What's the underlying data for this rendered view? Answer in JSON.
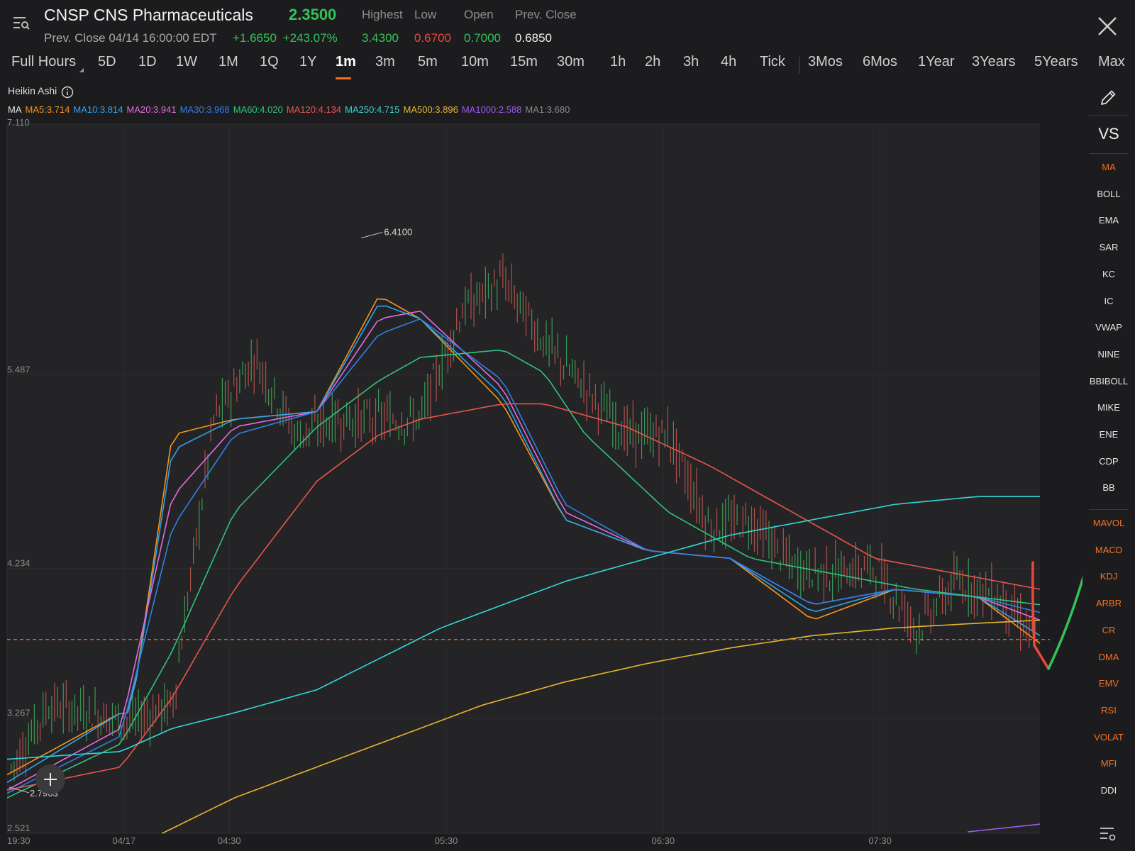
{
  "header": {
    "ticker_title": "CNSP CNS Pharmaceuticals",
    "price": "2.3500",
    "prev_close_line": "Prev. Close 04/14 16:00:00 EDT",
    "change_abs": "+1.6650",
    "change_pct": "+243.07%",
    "stats": [
      {
        "label": "Highest",
        "value": "3.4300",
        "color": "#33c25a"
      },
      {
        "label": "Low",
        "value": "0.6700",
        "color": "#f0453a"
      },
      {
        "label": "Open",
        "value": "0.7000",
        "color": "#33c25a"
      },
      {
        "label": "Prev. Close",
        "value": "0.6850",
        "color": "#f2f2f2"
      }
    ],
    "menu_icon": "list-search-icon",
    "close_icon": "close-icon"
  },
  "tabs": [
    "Full Hours",
    "5D",
    "1D",
    "1W",
    "1M",
    "1Q",
    "1Y",
    "1m",
    "3m",
    "5m",
    "10m",
    "15m",
    "30m",
    "1h",
    "2h",
    "3h",
    "4h",
    "Tick",
    "3Mos",
    "6Mos",
    "1Year",
    "3Years",
    "5Years",
    "Max"
  ],
  "active_tab": "1m",
  "chart_type_label": "Heikin Ashi",
  "ma_legend": [
    {
      "label": "MA",
      "color": "#e6e6e6"
    },
    {
      "label": "MA5:3.714",
      "color": "#f7941d"
    },
    {
      "label": "MA10:3.814",
      "color": "#2ea4e8"
    },
    {
      "label": "MA20:3.941",
      "color": "#e36be0"
    },
    {
      "label": "MA30:3.968",
      "color": "#2f7fe6"
    },
    {
      "label": "MA60:4.020",
      "color": "#2fc47a"
    },
    {
      "label": "MA120:4.134",
      "color": "#e8554e"
    },
    {
      "label": "MA250:4.715",
      "color": "#33d6d6"
    },
    {
      "label": "MA500:3.896",
      "color": "#e6b52e"
    },
    {
      "label": "MA1000:2.588",
      "color": "#9b59f0"
    },
    {
      "label": "MA1:3.680",
      "color": "#8a8a8a"
    }
  ],
  "sidebar": {
    "edit_icon": "pencil-icon",
    "vs_label": "VS",
    "overlay_items": [
      {
        "label": "MA",
        "color": "#f37021"
      },
      {
        "label": "BOLL",
        "color": "#e6e6e6"
      },
      {
        "label": "EMA",
        "color": "#e6e6e6"
      },
      {
        "label": "SAR",
        "color": "#e6e6e6"
      },
      {
        "label": "KC",
        "color": "#e6e6e6"
      },
      {
        "label": "IC",
        "color": "#e6e6e6"
      },
      {
        "label": "VWAP",
        "color": "#e6e6e6"
      },
      {
        "label": "NINE",
        "color": "#e6e6e6"
      },
      {
        "label": "BBIBOLL",
        "color": "#e6e6e6"
      },
      {
        "label": "MIKE",
        "color": "#e6e6e6"
      },
      {
        "label": "ENE",
        "color": "#e6e6e6"
      },
      {
        "label": "CDP",
        "color": "#e6e6e6"
      },
      {
        "label": "BB",
        "color": "#e6e6e6"
      }
    ],
    "indicator_items": [
      {
        "label": "MAVOL",
        "color": "#f37021"
      },
      {
        "label": "MACD",
        "color": "#f37021"
      },
      {
        "label": "KDJ",
        "color": "#f37021"
      },
      {
        "label": "ARBR",
        "color": "#f37021"
      },
      {
        "label": "CR",
        "color": "#f37021"
      },
      {
        "label": "DMA",
        "color": "#f37021"
      },
      {
        "label": "EMV",
        "color": "#f37021"
      },
      {
        "label": "RSI",
        "color": "#f37021"
      },
      {
        "label": "VOLAT",
        "color": "#f37021"
      },
      {
        "label": "MFI",
        "color": "#f37021"
      },
      {
        "label": "DDI",
        "color": "#e6e6e6"
      }
    ],
    "settings_icon": "settings-list-icon"
  },
  "add_button_icon": "plus-icon",
  "chart_data": {
    "type": "line",
    "subtype": "heikin-ashi candles with moving averages",
    "ylim": [
      2.521,
      7.11
    ],
    "y_ticks": [
      "7.110",
      "5.487",
      "4.234",
      "3.267",
      "2.521"
    ],
    "x_ticks": [
      "19:30",
      "04/17",
      "04:30",
      "05:30",
      "06:30",
      "07:30"
    ],
    "high_marker": "6.4100",
    "low_marker": "2.7963",
    "reference_line": {
      "value": 3.775,
      "color": "#f37021",
      "style": "dashed"
    },
    "price_series": {
      "x": [
        0,
        4,
        8,
        12,
        16,
        20,
        24,
        28,
        32,
        36,
        40,
        44,
        48,
        52,
        56,
        60,
        64,
        68,
        72,
        76,
        80,
        84,
        88,
        92,
        96,
        100
      ],
      "y": [
        2.9,
        3.35,
        3.3,
        3.25,
        3.35,
        5.2,
        5.6,
        5.1,
        5.2,
        5.2,
        5.2,
        5.9,
        6.1,
        5.7,
        5.4,
        5.1,
        5.1,
        4.5,
        4.55,
        4.25,
        4.2,
        4.25,
        3.85,
        4.15,
        4.05,
        3.75
      ]
    },
    "series": [
      {
        "name": "MA5",
        "color": "#f7941d",
        "x": [
          0,
          11,
          12,
          16,
          22,
          30,
          36,
          40,
          48,
          54,
          62,
          70,
          78,
          86,
          94,
          100
        ],
        "y": [
          2.9,
          3.3,
          3.3,
          5.1,
          5.2,
          5.25,
          6.0,
          5.85,
          5.3,
          4.55,
          4.35,
          4.3,
          3.9,
          4.1,
          4.05,
          3.75
        ]
      },
      {
        "name": "MA10",
        "color": "#2ea4e8",
        "x": [
          0,
          11,
          12,
          16,
          22,
          30,
          36,
          40,
          48,
          54,
          62,
          70,
          78,
          86,
          94,
          100
        ],
        "y": [
          2.85,
          3.3,
          3.3,
          5.0,
          5.2,
          5.25,
          5.95,
          5.85,
          5.35,
          4.55,
          4.35,
          4.3,
          3.95,
          4.1,
          4.05,
          3.8
        ]
      },
      {
        "name": "MA20",
        "color": "#e36be0",
        "x": [
          0,
          11,
          16,
          22,
          30,
          36,
          40,
          48,
          54,
          62,
          70,
          78,
          86,
          94,
          100
        ],
        "y": [
          2.8,
          3.2,
          4.7,
          5.15,
          5.25,
          5.85,
          5.9,
          5.4,
          4.6,
          4.35,
          4.3,
          4.0,
          4.1,
          4.05,
          3.9
        ]
      },
      {
        "name": "MA30",
        "color": "#2f7fe6",
        "x": [
          0,
          11,
          16,
          22,
          30,
          36,
          40,
          48,
          54,
          62,
          70,
          78,
          86,
          94,
          100
        ],
        "y": [
          2.78,
          3.15,
          4.5,
          5.1,
          5.25,
          5.75,
          5.85,
          5.45,
          4.65,
          4.35,
          4.3,
          4.0,
          4.1,
          4.05,
          3.95
        ]
      },
      {
        "name": "MA60",
        "color": "#2fc47a",
        "x": [
          0,
          11,
          16,
          22,
          30,
          36,
          40,
          48,
          52,
          56,
          64,
          72,
          80,
          88,
          100
        ],
        "y": [
          2.75,
          3.1,
          3.7,
          4.6,
          5.15,
          5.45,
          5.6,
          5.65,
          5.5,
          5.1,
          4.6,
          4.3,
          4.2,
          4.1,
          4.0
        ]
      },
      {
        "name": "MA120",
        "color": "#e8554e",
        "x": [
          0,
          11,
          16,
          22,
          30,
          36,
          40,
          48,
          52,
          60,
          68,
          76,
          84,
          92,
          100
        ],
        "y": [
          2.8,
          2.95,
          3.4,
          4.1,
          4.8,
          5.1,
          5.2,
          5.3,
          5.3,
          5.15,
          4.9,
          4.6,
          4.3,
          4.2,
          4.1
        ]
      },
      {
        "name": "MA250",
        "color": "#33d6d6",
        "x": [
          0,
          11,
          16,
          22,
          30,
          36,
          42,
          48,
          54,
          62,
          70,
          78,
          86,
          94,
          100
        ],
        "y": [
          3.0,
          3.05,
          3.2,
          3.3,
          3.45,
          3.65,
          3.85,
          4.0,
          4.15,
          4.3,
          4.45,
          4.55,
          4.65,
          4.7,
          4.7
        ]
      },
      {
        "name": "MA500",
        "color": "#e6b52e",
        "x": [
          15,
          22,
          30,
          38,
          46,
          54,
          62,
          70,
          78,
          86,
          94,
          100
        ],
        "y": [
          2.52,
          2.75,
          2.95,
          3.15,
          3.35,
          3.5,
          3.62,
          3.72,
          3.8,
          3.85,
          3.88,
          3.9
        ]
      },
      {
        "name": "MA1000",
        "color": "#9b59f0",
        "x": [
          93,
          100
        ],
        "y": [
          2.53,
          2.58
        ]
      }
    ]
  },
  "scroll_indicator": {
    "red_color": "#f0453a",
    "green_color": "#33c25a"
  }
}
